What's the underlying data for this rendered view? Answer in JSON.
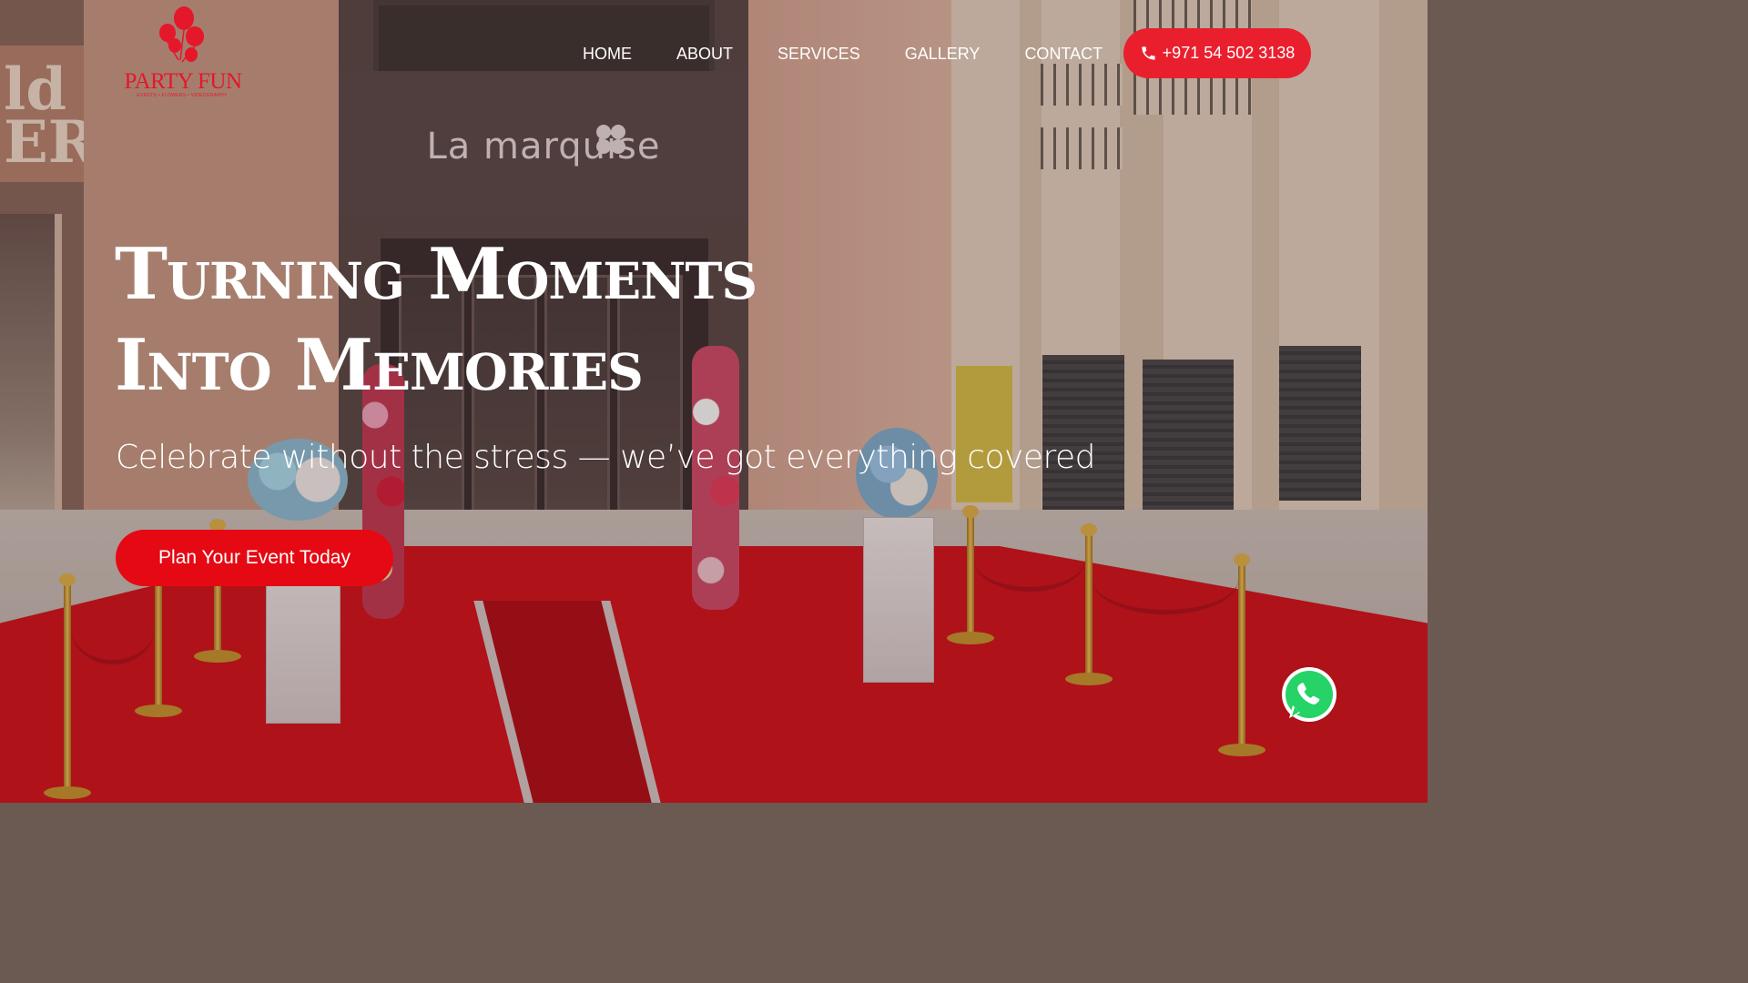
{
  "brand": {
    "name": "PARTY FUN",
    "tagline": "EVENTS • FLOWERS • VIDEOGRAPHY",
    "color": "#e5172a"
  },
  "nav": {
    "items": [
      {
        "label": "HOME"
      },
      {
        "label": "ABOUT"
      },
      {
        "label": "SERVICES"
      },
      {
        "label": "GALLERY"
      },
      {
        "label": "CONTACT"
      }
    ]
  },
  "header": {
    "phone_label": "+971 54 502 3138",
    "phone_icon": "phone-icon",
    "accent": "#ea1f2e"
  },
  "hero": {
    "title_line1": "Turning Moments",
    "title_line2": "Into Memories",
    "subtitle": "Celebrate without the stress — we’ve got everything covered",
    "cta_label": "Plan Your Event Today",
    "cta_color": "#e50914"
  },
  "background": {
    "storefront_sign": "La marquise",
    "left_sign": "ld\nERY"
  },
  "floating": {
    "whatsapp_icon": "whatsapp-icon"
  }
}
